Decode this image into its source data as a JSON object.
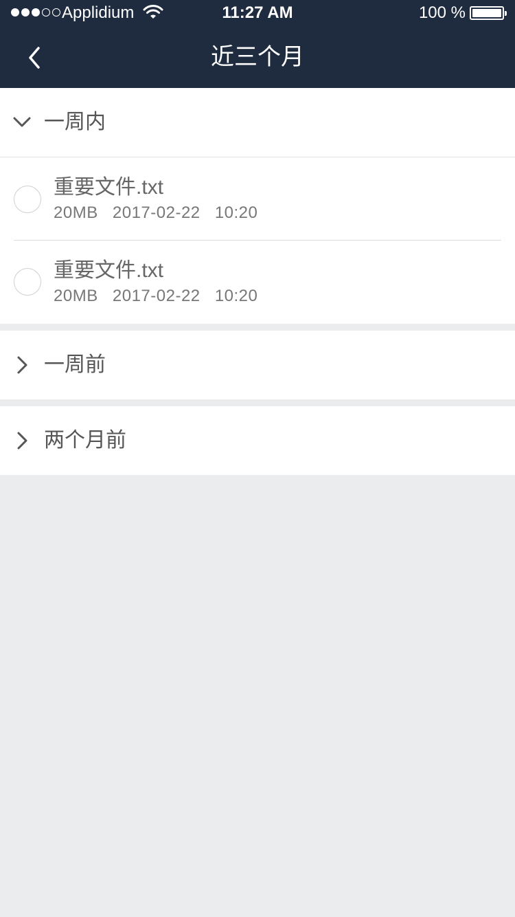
{
  "status_bar": {
    "carrier": "Applidium",
    "time": "11:27 AM",
    "battery": "100 %",
    "signal_bars_filled": 3,
    "signal_bars_total": 5
  },
  "nav": {
    "title": "近三个月",
    "back_icon": "chevron-left-icon"
  },
  "sections": [
    {
      "label": "一周内",
      "expanded": true,
      "files": [
        {
          "name": "重要文件.txt",
          "size": "20MB",
          "date": "2017-02-22",
          "time": "10:20"
        },
        {
          "name": "重要文件.txt",
          "size": "20MB",
          "date": "2017-02-22",
          "time": "10:20"
        }
      ]
    },
    {
      "label": "一周前",
      "expanded": false,
      "files": []
    },
    {
      "label": "两个月前",
      "expanded": false,
      "files": []
    }
  ],
  "colors": {
    "header_bg": "#1f2b3e",
    "page_bg": "#ebecee",
    "text_primary": "#555555",
    "text_secondary": "#777777"
  }
}
